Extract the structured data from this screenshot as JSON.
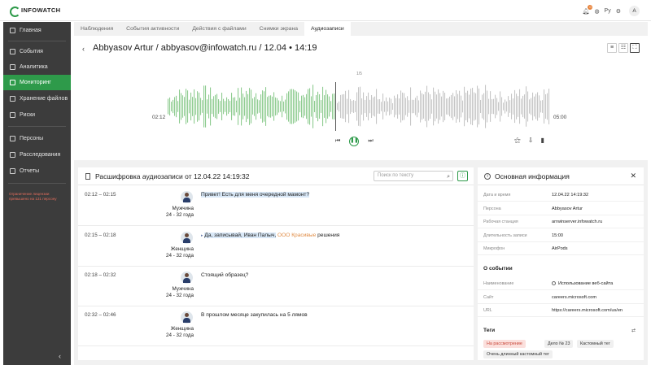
{
  "app": {
    "logo_text": "INFOWATCH",
    "brand_color": "#2e9a4a"
  },
  "topbar": {
    "notification_count": "0",
    "lang": "Ру",
    "user_initial": "A"
  },
  "sidebar": {
    "items": [
      {
        "label": "Главная",
        "icon": "home-icon"
      },
      {
        "label": "События",
        "icon": "events-icon"
      },
      {
        "label": "Аналитика",
        "icon": "analytics-icon"
      },
      {
        "label": "Мониторинг",
        "icon": "monitoring-icon",
        "active": true
      },
      {
        "label": "Хранение файлов",
        "icon": "storage-icon"
      },
      {
        "label": "Риски",
        "icon": "risks-icon"
      },
      {
        "label": "Персоны",
        "icon": "persons-icon"
      },
      {
        "label": "Расследования",
        "icon": "investigations-icon"
      },
      {
        "label": "Отчеты",
        "icon": "reports-icon"
      }
    ],
    "license_warning": "Ограничение лицензии превышено на 131 персону",
    "collapse_label": "‹"
  },
  "tabs": [
    "Наблюдения",
    "События активности",
    "Действия с файлами",
    "Снимки экрана",
    "Аудиозаписи"
  ],
  "active_tab": "Аудиозаписи",
  "player": {
    "title": "Abbyasov Artur / abbyasov@infowatch.ru / 12.04 • 14:19",
    "counter": "1/5",
    "current_time": "02:12",
    "total_time": "05:00",
    "progress": 0.44,
    "played_color": "#8fcc91",
    "unplayed_color": "#c6c6c6"
  },
  "transcript": {
    "title": "Расшифровка аудиозаписи от 12.04.22 14:19:32",
    "search_placeholder": "Поиск по тексту",
    "rows": [
      {
        "time": "02:12 – 02:15",
        "gender": "Мужчина",
        "age": "24 - 32 года",
        "text": "Привет! Есть для меня очередной мамонт?"
      },
      {
        "time": "02:15 – 02:18",
        "gender": "Женщина",
        "age": "24 - 32 года",
        "text_a": "Да, записывай, Иван Палыч,",
        "text_org": "ООО Красивые",
        "text_b": "решения"
      },
      {
        "time": "02:18 – 02:32",
        "gender": "Мужчина",
        "age": "24 - 32 года",
        "text": "Стоящий образец?"
      },
      {
        "time": "02:32 – 02:46",
        "gender": "Женщина",
        "age": "24 - 32 года",
        "text": "В прошлом месяце закупилась на 5 лямов"
      }
    ]
  },
  "info": {
    "title": "Основная информация",
    "fields": [
      {
        "label": "Дата и время",
        "value": "12.04.22 14:19:32"
      },
      {
        "label": "Персона",
        "value": "Abbyasov Artur"
      },
      {
        "label": "Рабочая станция",
        "value": "arrwinserver.infowatch.ru"
      },
      {
        "label": "Длительность записи",
        "value": "15:00"
      },
      {
        "label": "Микрофон",
        "value": "AirPods"
      }
    ],
    "event_section": "О событии",
    "event_fields": [
      {
        "label": "Наименование",
        "value": "Использование веб-сайта"
      },
      {
        "label": "Сайт",
        "value": "careers.microsoft.com"
      },
      {
        "label": "URL",
        "value": "https://careers.microsoft.com/us/en"
      }
    ],
    "tags_section": "Теги",
    "tags": [
      "На рассмотрение",
      "Дело № 23",
      "Кастомный тег",
      "Очень длинный кастомный тег"
    ]
  }
}
